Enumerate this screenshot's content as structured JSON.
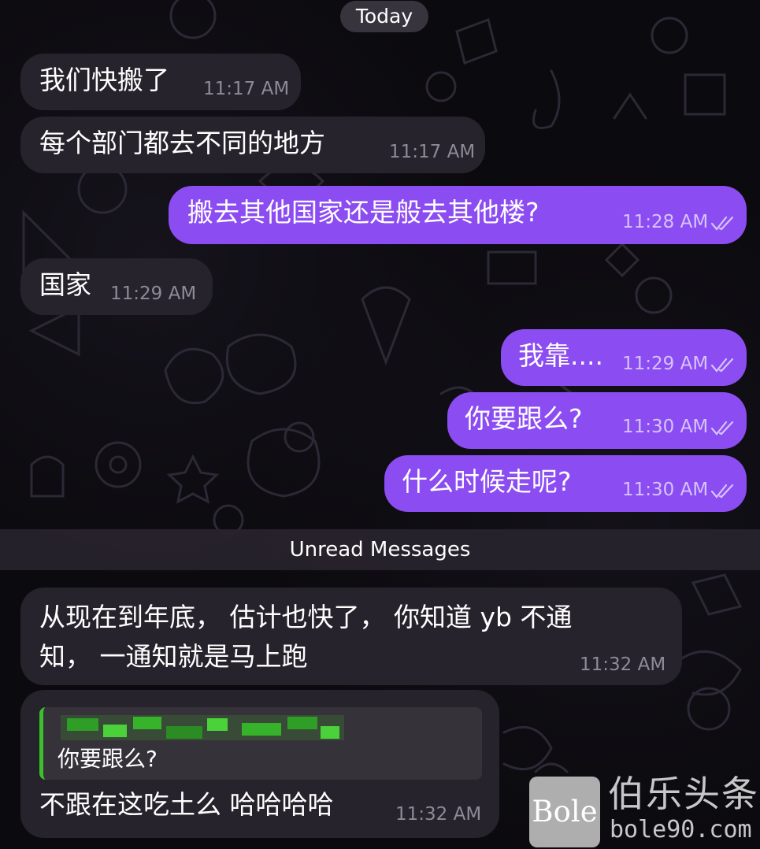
{
  "date_separator": "Today",
  "messages": [
    {
      "text": "我们快搬了",
      "time": "11:17 AM"
    },
    {
      "text": "每个部门都去不同的地方",
      "time": "11:17 AM"
    },
    {
      "text": "搬去其他国家还是般去其他楼?",
      "time": "11:28 AM"
    },
    {
      "text": "国家",
      "time": "11:29 AM"
    },
    {
      "text": "我靠....",
      "time": "11:29 AM"
    },
    {
      "text": "你要跟么?",
      "time": "11:30 AM"
    },
    {
      "text": "什么时候走呢?",
      "time": "11:30 AM"
    },
    {
      "line1": "从现在到年底， 估计也快了， 你知道 yb 不通",
      "line2": "知， 一通知就是马上跑",
      "time": "11:32 AM"
    },
    {
      "reply_text": "你要跟么?",
      "text": "不跟在这吃土么 哈哈哈哈",
      "time": "11:32 AM"
    }
  ],
  "unread_divider": "Unread Messages",
  "watermark": {
    "logo": "Bole",
    "name": "伯乐头条",
    "url": "bole90.com"
  },
  "colors": {
    "outgoing": "#8b4cf2",
    "incoming": "#27232c",
    "reply_bar": "#3bbf2c"
  }
}
